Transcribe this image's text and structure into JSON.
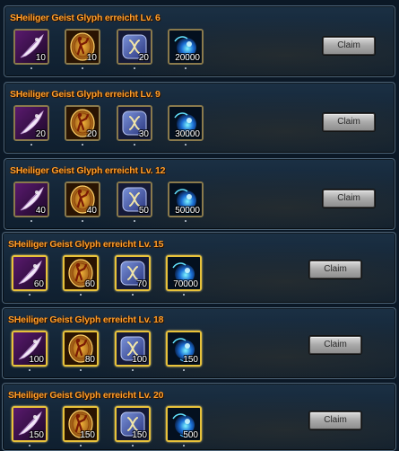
{
  "claim_label": "Claim",
  "colors": {
    "title": "#ff9e2b",
    "slot_border": "#8a7a4c",
    "slot_border_highlight": "#e8c23a"
  },
  "icons": [
    "feather-icon",
    "shield-figure-icon",
    "rune-icon",
    "blue-orb-icon"
  ],
  "rows": [
    {
      "title": "SHeiliger Geist Glyph erreicht Lv. 6",
      "quantities": [
        "10",
        "10",
        "20",
        "20000"
      ]
    },
    {
      "title": "SHeiliger Geist Glyph erreicht Lv. 9",
      "quantities": [
        "20",
        "20",
        "30",
        "30000"
      ]
    },
    {
      "title": "SHeiliger Geist Glyph erreicht Lv. 12",
      "quantities": [
        "40",
        "40",
        "50",
        "50000"
      ]
    },
    {
      "title": "SHeiliger Geist Glyph erreicht Lv. 15",
      "quantities": [
        "60",
        "60",
        "70",
        "70000"
      ]
    },
    {
      "title": "SHeiliger Geist Glyph erreicht Lv. 18",
      "quantities": [
        "100",
        "80",
        "100",
        "150"
      ]
    },
    {
      "title": "SHeiliger Geist Glyph erreicht Lv. 20",
      "quantities": [
        "150",
        "150",
        "150",
        "500"
      ]
    }
  ]
}
